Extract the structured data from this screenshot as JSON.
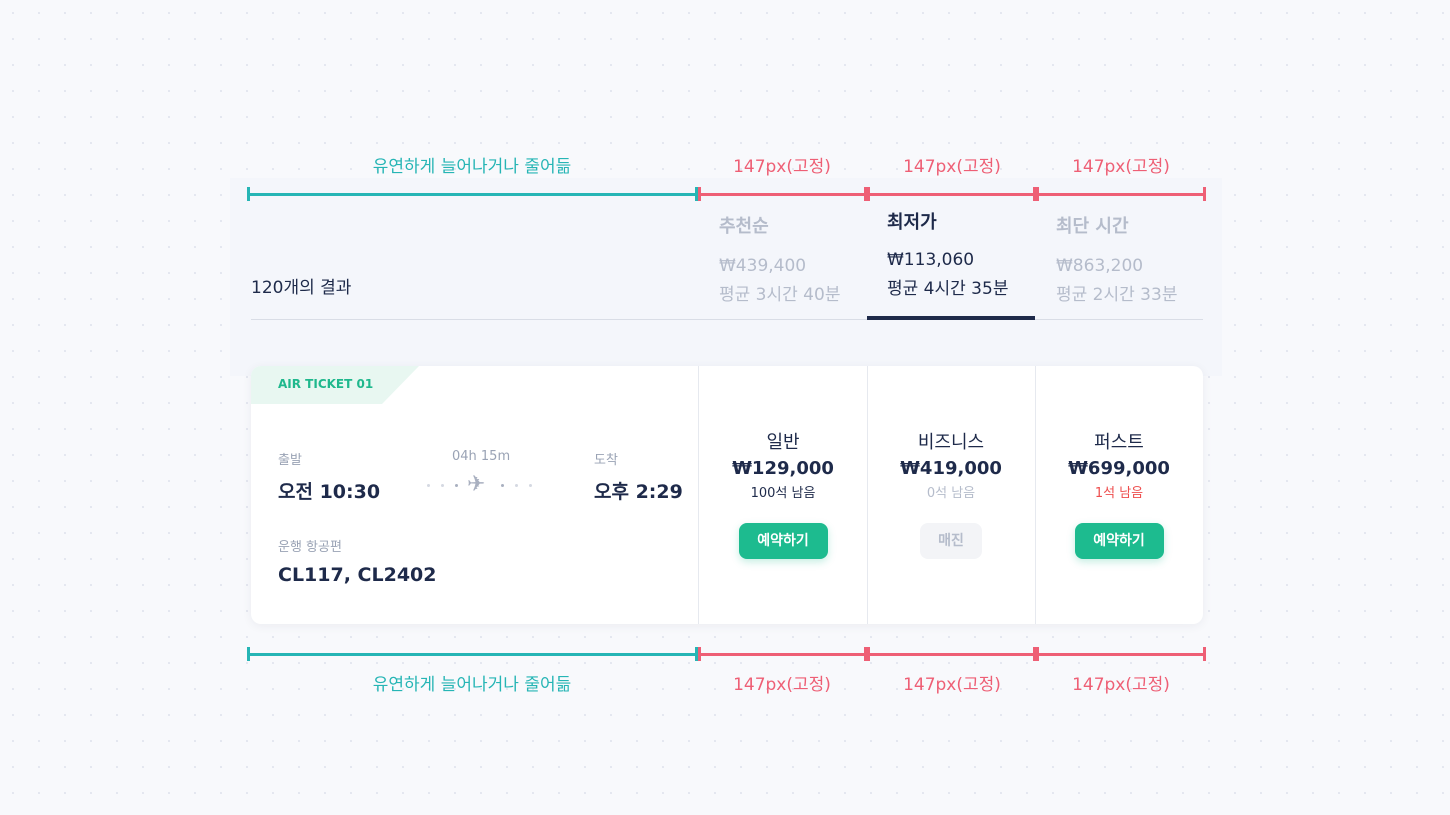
{
  "annotations": {
    "flex_label": "유연하게 늘어나거나 줄어듦",
    "fixed_label": "147px(고정)"
  },
  "colors": {
    "teal": "#26b5b5",
    "red": "#ee5f75",
    "green": "#1dbb8f",
    "navy": "#1e2a4a"
  },
  "results": {
    "count_label": "120개의 결과"
  },
  "sort_tabs": [
    {
      "name": "추천순",
      "price": "₩439,400",
      "avg": "평균 3시간 40분",
      "active": false
    },
    {
      "name": "최저가",
      "price": "₩113,060",
      "avg": "평균 4시간 35분",
      "active": true
    },
    {
      "name": "최단 시간",
      "price": "₩863,200",
      "avg": "평균 2시간 33분",
      "active": false
    }
  ],
  "ticket": {
    "tag": "AIR TICKET 01",
    "departure_label": "출발",
    "departure_time": "오전 10:30",
    "duration": "04h 15m",
    "arrival_label": "도착",
    "arrival_time": "오후 2:29",
    "flights_label": "운행 항공편",
    "flights": "CL117, CL2402",
    "plane_icon": "airplane-icon",
    "fares": [
      {
        "class": "일반",
        "price": "₩129,000",
        "seats": "100석 남음",
        "button": "예약하기",
        "status": "available"
      },
      {
        "class": "비즈니스",
        "price": "₩419,000",
        "seats": "0석 남음",
        "button": "매진",
        "status": "soldout"
      },
      {
        "class": "퍼스트",
        "price": "₩699,000",
        "seats": "1석 남음",
        "button": "예약하기",
        "status": "last"
      }
    ]
  }
}
